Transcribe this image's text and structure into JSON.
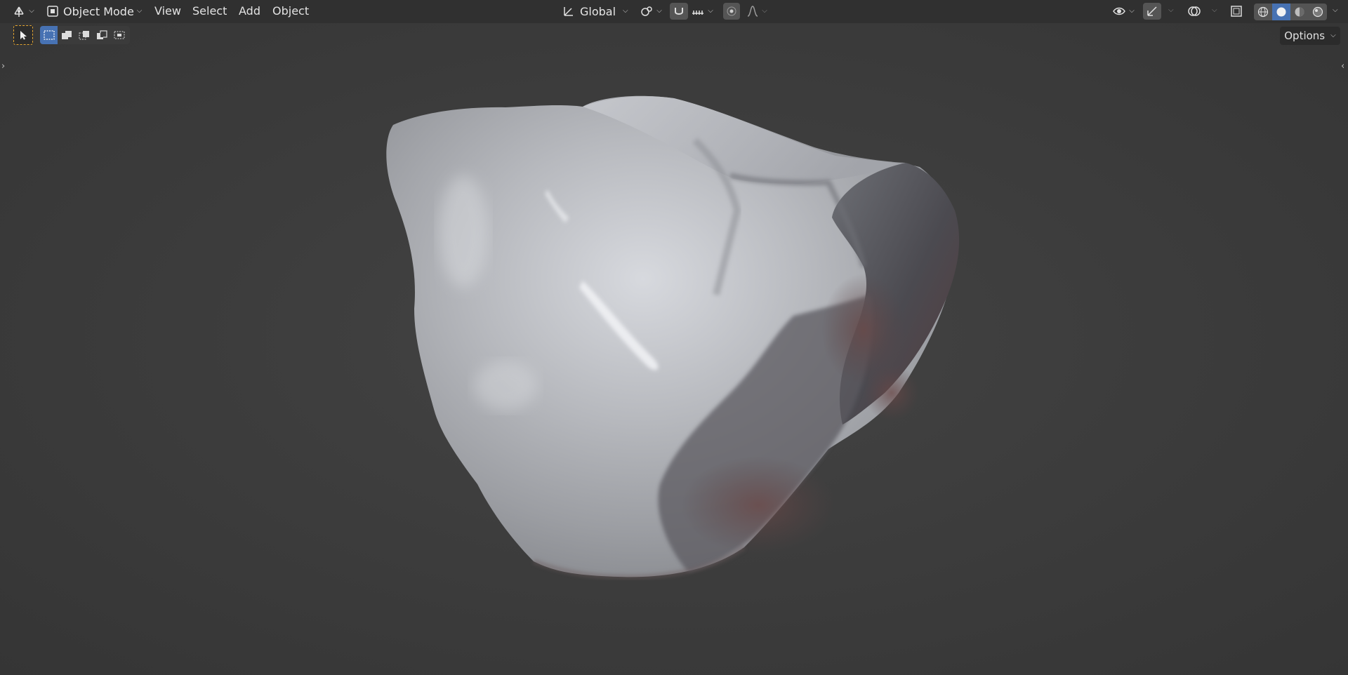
{
  "header": {
    "editor_type_icon": "viewport-gizmo-icon",
    "mode_label": "Object Mode",
    "menus": [
      "View",
      "Select",
      "Add",
      "Object"
    ],
    "transform_orientation": "Global",
    "pivot_icon": "pivot-link-icon",
    "snap_icon": "snap-magnet-icon",
    "snap_target_icon": "snap-increment-icon",
    "proportional_icon": "proportional-edit-icon",
    "falloff_icon": "falloff-curve-icon",
    "visibility_icon": "eye-icon",
    "gizmo_icon": "gizmo-icon",
    "overlay_icon": "overlay-icon",
    "xray_icon": "xray-icon",
    "shading_modes": [
      "wireframe",
      "solid",
      "material-preview",
      "rendered"
    ],
    "active_shading": "solid",
    "accent_color": "#4772b3"
  },
  "toolbar": {
    "active_tool": "select-box",
    "select_modes": [
      "new",
      "extend",
      "subtract",
      "invert",
      "intersect"
    ],
    "active_select_mode": "new",
    "options_label": "Options"
  },
  "viewport": {
    "object": "rock-mesh",
    "background_color": "#3d3d3d"
  }
}
